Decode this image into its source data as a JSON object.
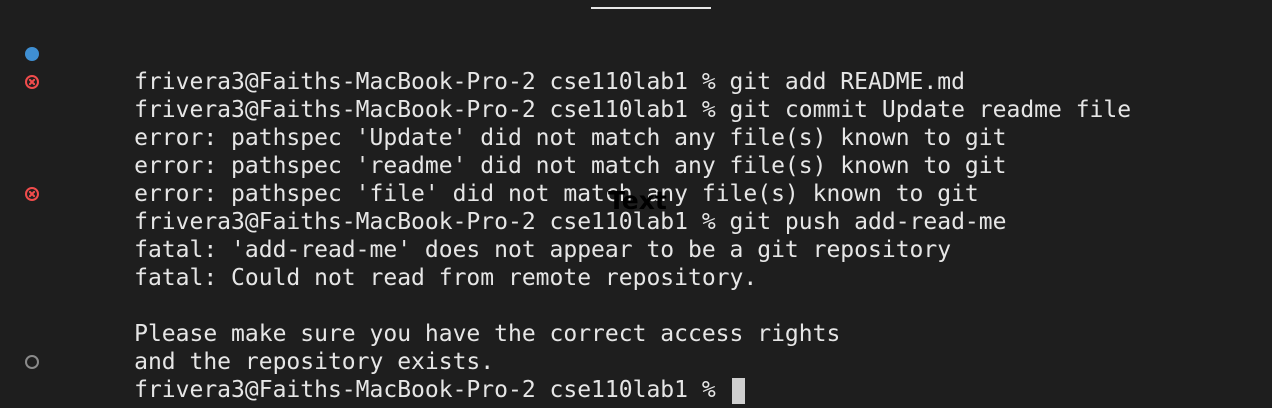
{
  "terminal": {
    "colors": {
      "background": "#1e1e1e",
      "foreground": "#e6e6e6",
      "success_marker": "#3f8fd2",
      "error_marker": "#f14c4c",
      "pending_marker": "#8a8a8a"
    },
    "lines": [
      {
        "marker": "success-dot-icon",
        "text": "frivera3@Faiths-MacBook-Pro-2 cse110lab1 % git add README.md"
      },
      {
        "marker": "error-circle-x-icon",
        "text": "frivera3@Faiths-MacBook-Pro-2 cse110lab1 % git commit Update readme file"
      },
      {
        "marker": null,
        "text": "error: pathspec 'Update' did not match any file(s) known to git"
      },
      {
        "marker": null,
        "text": "error: pathspec 'readme' did not match any file(s) known to git"
      },
      {
        "marker": null,
        "text": "error: pathspec 'file' did not match any file(s) known to git"
      },
      {
        "marker": "error-circle-x-icon",
        "text": "frivera3@Faiths-MacBook-Pro-2 cse110lab1 % git push add-read-me"
      },
      {
        "marker": null,
        "text": "fatal: 'add-read-me' does not appear to be a git repository"
      },
      {
        "marker": null,
        "text": "fatal: Could not read from remote repository."
      },
      {
        "marker": null,
        "text": ""
      },
      {
        "marker": null,
        "text": "Please make sure you have the correct access rights"
      },
      {
        "marker": null,
        "text": "and the repository exists."
      },
      {
        "marker": "pending-circle-icon",
        "text": "frivera3@Faiths-MacBook-Pro-2 cse110lab1 % "
      }
    ],
    "overlay_text": "Text"
  }
}
